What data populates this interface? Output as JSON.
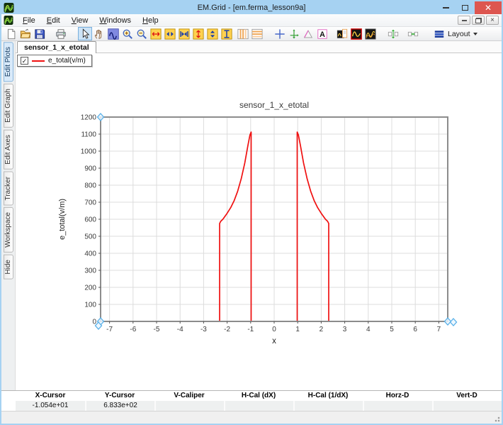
{
  "window": {
    "title": "EM.Grid - [em.ferma_lesson9a]"
  },
  "menu": {
    "items": [
      "File",
      "Edit",
      "View",
      "Windows",
      "Help"
    ]
  },
  "toolbar": {
    "layout_label": "Layout",
    "buttons": [
      {
        "name": "new-file-button",
        "icon": "new-file-icon",
        "sym": "i-new"
      },
      {
        "name": "open-file-button",
        "icon": "open-folder-icon",
        "sym": "i-open"
      },
      {
        "name": "save-button",
        "icon": "floppy-disk-icon",
        "sym": "i-save"
      },
      {
        "name": "print-button",
        "icon": "printer-icon",
        "sym": "i-print",
        "gap": 10
      },
      {
        "name": "select-tool-button",
        "icon": "cursor-arrow-icon",
        "sym": "i-select",
        "gap": 14,
        "active": true
      },
      {
        "name": "pan-tool-button",
        "icon": "hand-icon",
        "sym": "i-pan"
      },
      {
        "name": "zoom-window-button",
        "icon": "zoom-window-icon",
        "sym": "i-zoomwin"
      },
      {
        "name": "zoom-in-button",
        "icon": "zoom-in-icon",
        "sym": "i-zoomin"
      },
      {
        "name": "zoom-out-button",
        "icon": "zoom-out-icon",
        "sym": "i-zoomout"
      },
      {
        "name": "expand-x-button",
        "icon": "expand-x-icon",
        "sym": "i-expx"
      },
      {
        "name": "compress-x-button",
        "icon": "compress-x-icon",
        "sym": "i-compx"
      },
      {
        "name": "fit-x-button",
        "icon": "fit-x-icon",
        "sym": "i-fitx"
      },
      {
        "name": "expand-y-button",
        "icon": "expand-y-icon",
        "sym": "i-expy"
      },
      {
        "name": "compress-y-button",
        "icon": "compress-y-icon",
        "sym": "i-compy"
      },
      {
        "name": "fit-y-button",
        "icon": "fit-y-icon",
        "sym": "i-fity"
      },
      {
        "name": "vertical-bands-button",
        "icon": "vertical-bands-icon",
        "sym": "i-vbands",
        "gap": 3
      },
      {
        "name": "horizontal-bands-button",
        "icon": "horizontal-bands-icon",
        "sym": "i-hbands"
      },
      {
        "name": "crosshair-button",
        "icon": "crosshair-icon",
        "sym": "i-cross",
        "gap": 12
      },
      {
        "name": "tracker-axes-button",
        "icon": "tracker-axes-icon",
        "sym": "i-axes"
      },
      {
        "name": "slope-tool-button",
        "icon": "delta-triangle-icon",
        "sym": "i-delta"
      },
      {
        "name": "text-annotation-button",
        "icon": "letter-a-icon",
        "sym": "i-texta"
      },
      {
        "name": "plot-template-button",
        "icon": "plot-page-icon",
        "sym": "i-plotpage",
        "gap": 8
      },
      {
        "name": "dark-plot-button",
        "icon": "dark-curve-icon",
        "sym": "i-plotdark"
      },
      {
        "name": "multi-plot-button",
        "icon": "multi-curve-icon",
        "sym": "i-plotmulti"
      },
      {
        "name": "space-vertical-button",
        "icon": "space-vertical-icon",
        "sym": "i-spacev",
        "gap": 12
      },
      {
        "name": "space-horizontal-button",
        "icon": "space-horizontal-icon",
        "sym": "i-spaceh",
        "gap": 8
      }
    ]
  },
  "side_tabs": {
    "items": [
      {
        "label": "Edit Plots",
        "selected": true
      },
      {
        "label": "Edit Graph",
        "selected": false
      },
      {
        "label": "Edit Axes",
        "selected": false
      },
      {
        "label": "Tracker",
        "selected": false
      },
      {
        "label": "Workspace",
        "selected": false
      },
      {
        "label": "Hide",
        "selected": false
      }
    ]
  },
  "doc_tab": {
    "label": "sensor_1_x_etotal"
  },
  "legend": {
    "checked": true,
    "check_glyph": "✓",
    "label": "e_total(v/m)",
    "line_color": "#f01010"
  },
  "chart_data": {
    "type": "line",
    "title": "sensor_1_x_etotal",
    "xlabel": "x",
    "ylabel": "e_total(v/m)",
    "xlim": [
      -7.38,
      7.38
    ],
    "ylim": [
      0,
      1200
    ],
    "xticks": [
      -7,
      -6,
      -5,
      -4,
      -3,
      -2,
      -1,
      0,
      1,
      2,
      3,
      4,
      5,
      6,
      7
    ],
    "yticks": [
      0,
      100,
      200,
      300,
      400,
      500,
      600,
      700,
      800,
      900,
      1000,
      1100,
      1200
    ],
    "grid": true,
    "legend_position": "top-left-floating",
    "series": [
      {
        "name": "e_total(v/m)",
        "color": "#f01010",
        "points": [
          [
            -7.38,
            0
          ],
          [
            -2.32,
            0
          ],
          [
            -2.32,
            575
          ],
          [
            -2.27,
            588
          ],
          [
            -2.18,
            600
          ],
          [
            -2.0,
            635
          ],
          [
            -1.85,
            668
          ],
          [
            -1.7,
            710
          ],
          [
            -1.55,
            765
          ],
          [
            -1.4,
            838
          ],
          [
            -1.25,
            930
          ],
          [
            -1.12,
            1030
          ],
          [
            -1.03,
            1095
          ],
          [
            -0.98,
            1112
          ],
          [
            -0.98,
            0
          ],
          [
            0.98,
            0
          ],
          [
            0.98,
            1112
          ],
          [
            1.03,
            1095
          ],
          [
            1.12,
            1030
          ],
          [
            1.25,
            930
          ],
          [
            1.4,
            838
          ],
          [
            1.55,
            765
          ],
          [
            1.7,
            710
          ],
          [
            1.85,
            668
          ],
          [
            2.0,
            635
          ],
          [
            2.18,
            600
          ],
          [
            2.27,
            588
          ],
          [
            2.32,
            575
          ],
          [
            2.32,
            0
          ],
          [
            7.38,
            0
          ]
        ]
      }
    ],
    "handles": [
      {
        "x": -7.38,
        "y": 1200
      },
      {
        "x": -7.38,
        "y": 0
      },
      {
        "x": 7.38,
        "y": 0
      }
    ]
  },
  "status_table": {
    "headers": [
      "X-Cursor",
      "Y-Cursor",
      "V-Caliper",
      "H-Cal (dX)",
      "H-Cal (1/dX)",
      "Horz-D",
      "Vert-D"
    ],
    "values": [
      "-1.054e+01",
      "6.833e+02",
      "",
      "",
      "",
      "",
      ""
    ]
  },
  "colors": {
    "titlebar": "#a6d2f2",
    "close_button": "#dd5650",
    "series_red": "#f01010",
    "grid": "#dcdcdc",
    "plot_frame": "#8c8c8c",
    "handle": "#58b0e8",
    "selection": "#cde4f7"
  }
}
